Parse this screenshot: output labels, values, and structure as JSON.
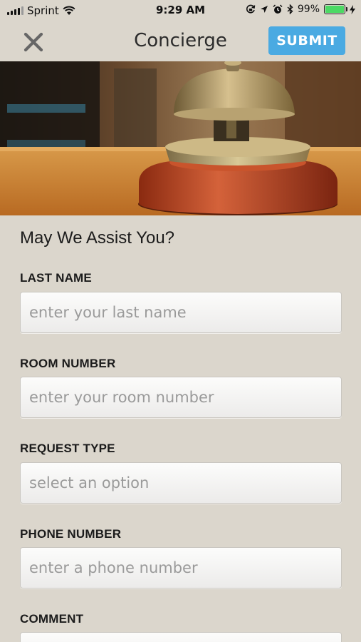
{
  "status_bar": {
    "carrier": "Sprint",
    "time": "9:29 AM",
    "battery_percent": "99%",
    "battery_level": 0.99,
    "icons": [
      "wifi-icon",
      "screen-lock-icon",
      "location-icon",
      "alarm-icon",
      "bluetooth-icon",
      "charging-icon"
    ]
  },
  "nav": {
    "close_icon": "close-icon",
    "title": "Concierge",
    "submit_label": "SUBMIT"
  },
  "hero": {
    "image": "service-bell-photo"
  },
  "form": {
    "heading": "May We Assist You?",
    "fields": [
      {
        "label": "LAST NAME",
        "placeholder": "enter your last name"
      },
      {
        "label": "ROOM NUMBER",
        "placeholder": "enter your room number"
      },
      {
        "label": "REQUEST TYPE",
        "placeholder": "select an option"
      },
      {
        "label": "PHONE NUMBER",
        "placeholder": "enter a phone number"
      },
      {
        "label": "COMMENT",
        "placeholder": ""
      }
    ]
  },
  "colors": {
    "background": "#dbd6cc",
    "accent": "#4aaae2",
    "battery": "#4cd964"
  }
}
